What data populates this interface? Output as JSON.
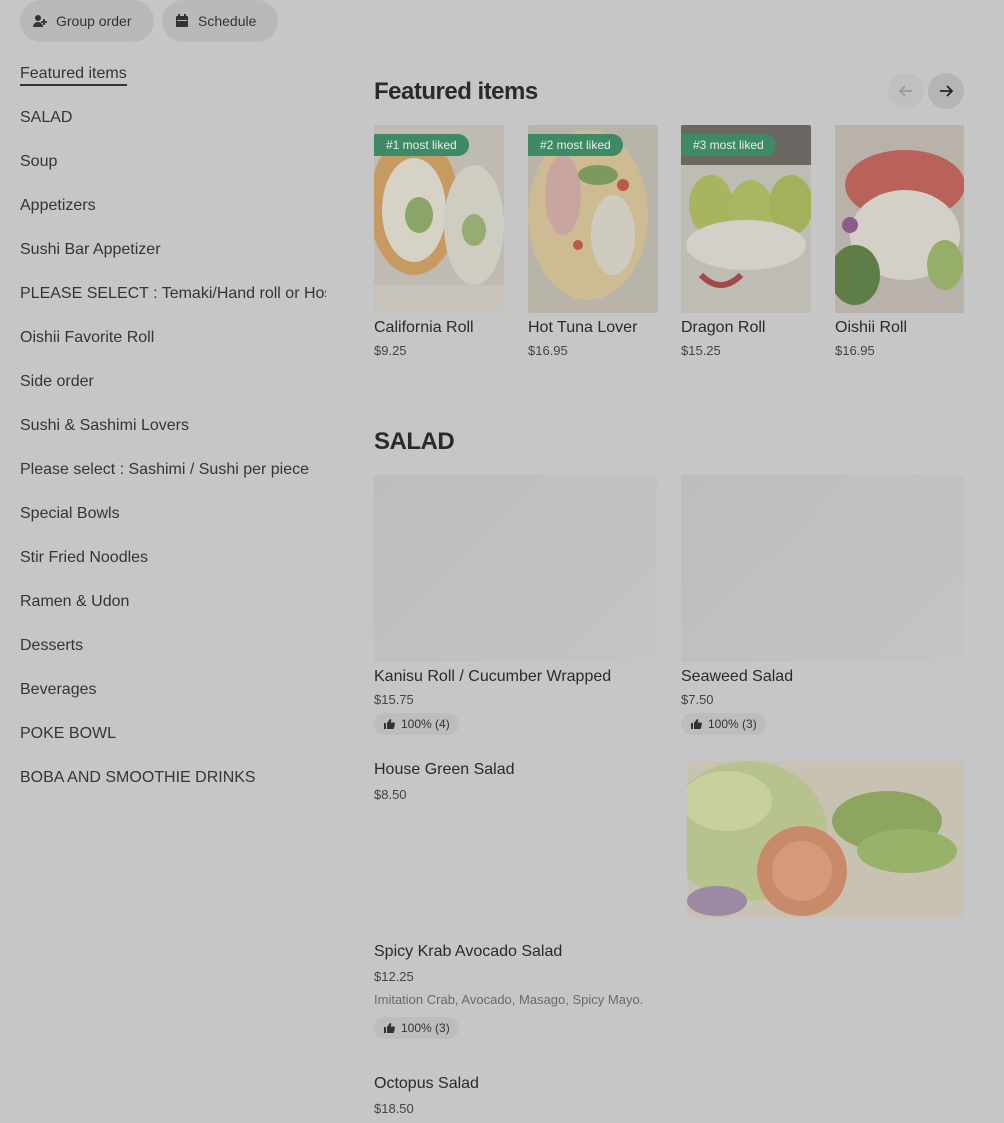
{
  "topbar": {
    "group_order": "Group order",
    "schedule": "Schedule"
  },
  "sidebar": {
    "items": [
      "Featured items",
      "SALAD",
      "Soup",
      "Appetizers",
      "Sushi Bar Appetizer",
      "PLEASE SELECT : Temaki/Hand roll or Hosomaki/Cut roll",
      "Oishii Favorite Roll",
      "Side order",
      "Sushi & Sashimi Lovers",
      "Please select : Sashimi / Sushi per piece",
      "Special Bowls",
      "Stir Fried Noodles",
      "Ramen & Udon",
      "Desserts",
      "Beverages",
      "POKE BOWL",
      "BOBA AND SMOOTHIE DRINKS"
    ]
  },
  "featured": {
    "title": "Featured items",
    "items": [
      {
        "badge": "#1 most liked",
        "name": "California Roll",
        "price": "$9.25"
      },
      {
        "badge": "#2 most liked",
        "name": "Hot Tuna Lover",
        "price": "$16.95"
      },
      {
        "badge": "#3 most liked",
        "name": "Dragon Roll",
        "price": "$15.25"
      },
      {
        "badge": "",
        "name": "Oishii Roll",
        "price": "$16.95"
      }
    ]
  },
  "salad": {
    "title": "SALAD",
    "cards": [
      {
        "name": "Kanisu Roll / Cucumber Wrapped",
        "price": "$15.75",
        "rating": "100% (4)"
      },
      {
        "name": "Seaweed Salad",
        "price": "$7.50",
        "rating": "100% (3)"
      }
    ],
    "rows": [
      {
        "name": "House Green Salad",
        "price": "$8.50"
      },
      {
        "name": "Spicy Krab Avocado Salad",
        "price": "$12.25",
        "desc": "Imitation Crab, Avocado, Masago, Spicy Mayo.",
        "rating": "100% (3)"
      },
      {
        "name": "Octopus Salad",
        "price": "$18.50"
      }
    ]
  }
}
